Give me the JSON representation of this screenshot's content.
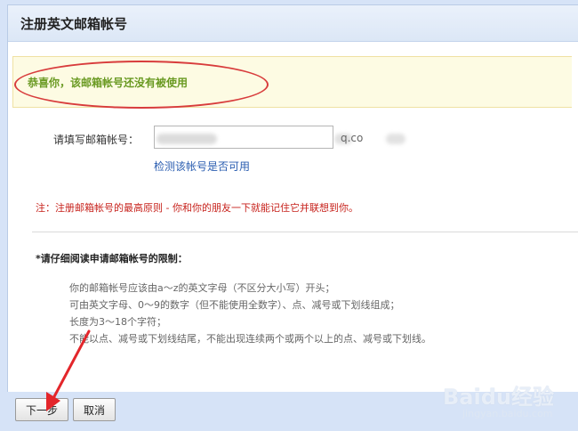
{
  "window": {
    "title": "注册英文邮箱帐号"
  },
  "notice": {
    "text": "恭喜你，该邮箱帐号还没有被使用"
  },
  "form": {
    "label": "请填写邮箱帐号：",
    "input_value": "",
    "suffix": "q.co",
    "check_link": "检测该帐号是否可用"
  },
  "note": {
    "text": "注：注册邮箱帐号的最高原则 - 你和你的朋友一下就能记住它并联想到你。"
  },
  "rules": {
    "heading": "*请仔细阅读申请邮箱帐号的限制：",
    "items": [
      "你的邮箱帐号应该由a～z的英文字母（不区分大小写）开头；",
      "可由英文字母、0～9的数字（但不能使用全数字）、点、减号或下划线组成；",
      "长度为3～18个字符；",
      "不能以点、减号或下划线结尾，不能出现连续两个或两个以上的点、减号或下划线。"
    ]
  },
  "buttons": {
    "next": "下一步",
    "cancel": "取消"
  },
  "watermark": {
    "text": "Baidu经验",
    "sub": "jingyan.baidu.com"
  },
  "colors": {
    "highlight_oval": "#d83c3c",
    "arrow": "#e3262b",
    "success_text": "#6a9a22",
    "link": "#2a5db0"
  }
}
